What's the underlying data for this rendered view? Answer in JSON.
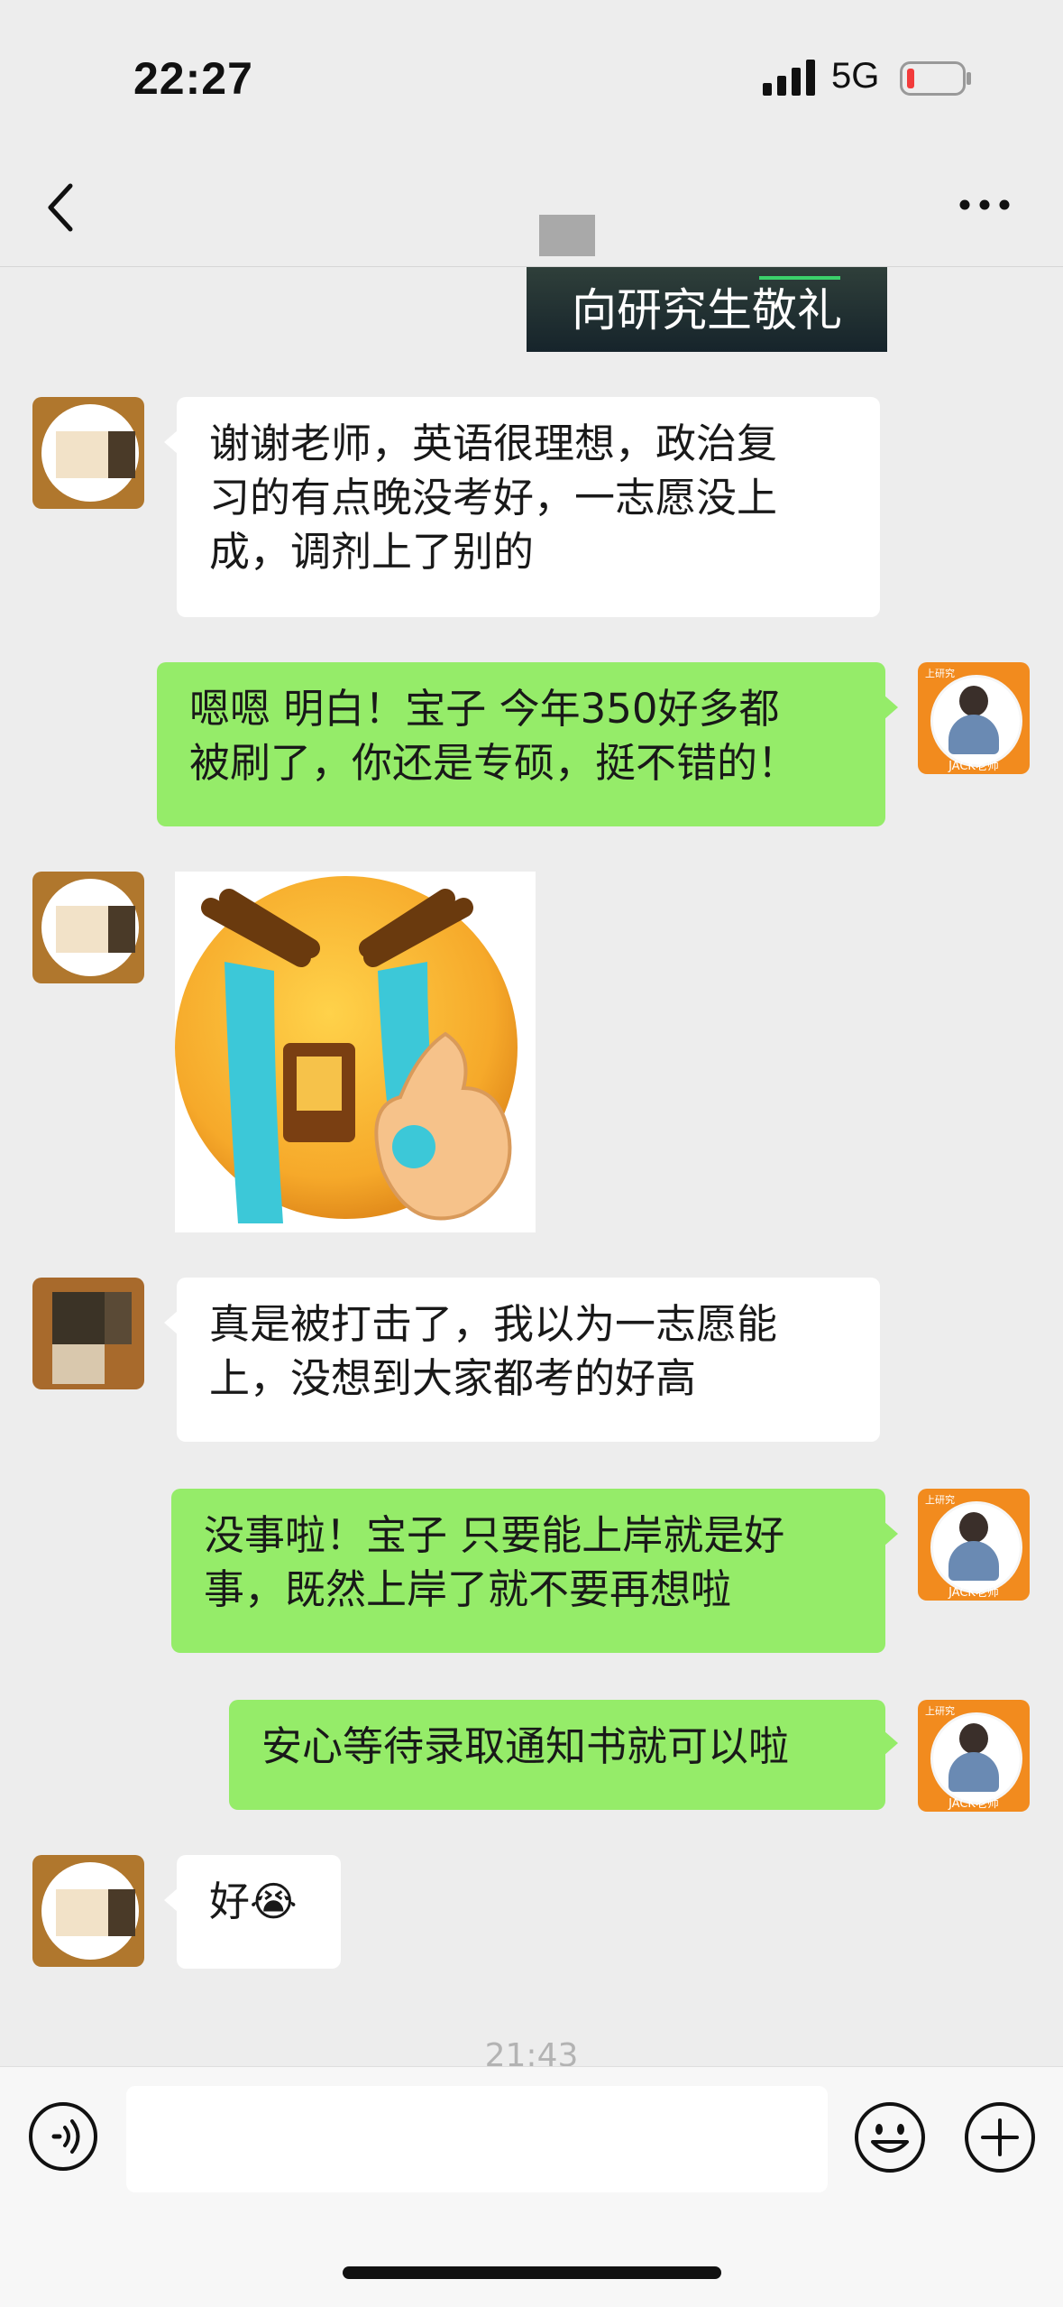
{
  "status_bar": {
    "time": "22:27",
    "network": "5G"
  },
  "nav": {
    "back_icon": "chevron-left-icon",
    "more_icon": "more-dots-icon"
  },
  "top_image": {
    "caption": "向研究生敬礼"
  },
  "messages": [
    {
      "side": "left",
      "text": "谢谢老师，英语很理想，政治复\n习的有点晚没考好，一志愿没上\n成，调剂上了别的"
    },
    {
      "side": "right",
      "text": "嗯嗯 明白！宝子 今年350好多都\n被刷了，你还是专硕，挺不错的！"
    },
    {
      "side": "left",
      "type": "sticker",
      "sticker": "crying-ok-emoji"
    },
    {
      "side": "left",
      "text": "真是被打击了，我以为一志愿能\n上，没想到大家都考的好高"
    },
    {
      "side": "right",
      "text": "没事啦！宝子 只要能上岸就是好\n事，既然上岸了就不要再想啦"
    },
    {
      "side": "right",
      "text": "安心等待录取通知书就可以啦"
    },
    {
      "side": "left",
      "text": "好😭"
    }
  ],
  "avatar_me": {
    "label": "JACK老师",
    "top_label": "上研究"
  },
  "timestamp": "21:43",
  "colors": {
    "background": "#ededed",
    "sent_bubble": "#95ec69",
    "received_bubble": "#ffffff"
  }
}
